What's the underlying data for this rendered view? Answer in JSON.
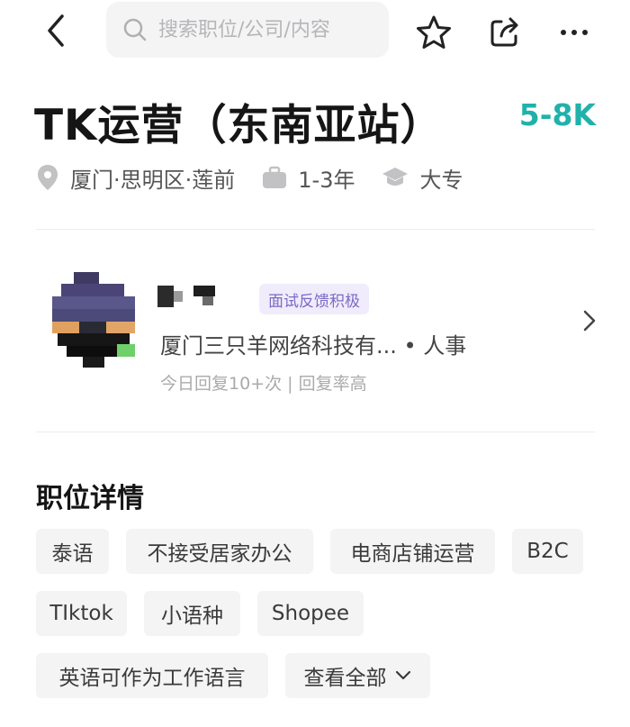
{
  "search": {
    "placeholder": "搜索职位/公司/内容"
  },
  "icons": {
    "back": "chevron-left-icon",
    "search": "search-icon",
    "favorite": "star-icon",
    "share": "share-icon",
    "more": "more-dots-icon",
    "location": "location-pin-icon",
    "experience": "briefcase-icon",
    "education": "graduation-cap-icon",
    "card_arrow": "chevron-right-icon",
    "view_all": "chevron-down-icon"
  },
  "job": {
    "title": "TK运营（东南亚站）",
    "salary": "5-8K",
    "location": "厦门·思明区·莲前",
    "experience": "1-3年",
    "education": "大专"
  },
  "recruiter": {
    "badge": "面试反馈积极",
    "company_line": "厦门三只羊网络科技有...  •  人事",
    "reply_stats": "今日回复10+次 | 回复率高"
  },
  "details": {
    "section_title": "职位详情",
    "tags": [
      "泰语",
      "不接受居家办公",
      "电商店铺运营",
      "B2C",
      "TIktok",
      "小语种",
      "Shopee",
      "英语可作为工作语言"
    ],
    "view_all_label": "查看全部"
  },
  "colors": {
    "salary": "#20b2aa",
    "badge_text": "#7b6ac6",
    "badge_bg": "#f0ecfb",
    "tag_bg": "#f4f4f5"
  }
}
